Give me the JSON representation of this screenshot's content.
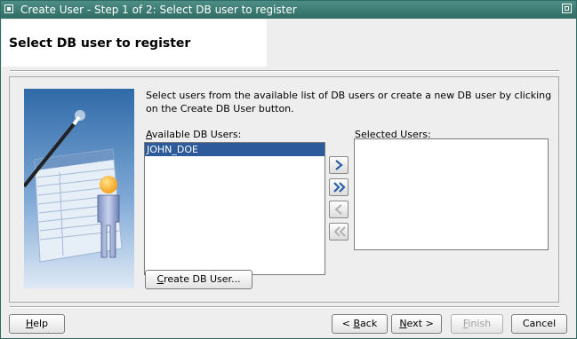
{
  "window": {
    "title": "Create User - Step 1 of 2: Select DB user to register"
  },
  "header": {
    "page_title": "Select DB user to register"
  },
  "main": {
    "instructions": "Select users from the available list of DB users or create a new DB user by clicking on the Create DB User button.",
    "available": {
      "label_pre": "",
      "label_key": "A",
      "label_post": "vailable DB Users:",
      "items": [
        "JOHN_DOE"
      ],
      "selected_index": 0
    },
    "selected": {
      "label_pre": "",
      "label_key": "S",
      "label_post": "elected Users:",
      "items": []
    },
    "shuttle_buttons": [
      {
        "name": "move-right",
        "icon": "chevron-right-icon",
        "enabled": true
      },
      {
        "name": "move-all-right",
        "icon": "double-chevron-right-icon",
        "enabled": true
      },
      {
        "name": "move-left",
        "icon": "chevron-left-icon",
        "enabled": false
      },
      {
        "name": "move-all-left",
        "icon": "double-chevron-left-icon",
        "enabled": false
      }
    ],
    "create_button": {
      "pre": "",
      "key": "C",
      "post": "reate DB User..."
    }
  },
  "footer": {
    "help": {
      "pre": "",
      "key": "H",
      "post": "elp"
    },
    "back": {
      "pre": "< ",
      "key": "B",
      "post": "ack"
    },
    "next": {
      "pre": "",
      "key": "N",
      "post": "ext >"
    },
    "finish": {
      "pre": "",
      "key": "F",
      "post": "inish",
      "enabled": false
    },
    "cancel": {
      "label": "Cancel"
    }
  },
  "colors": {
    "titlebar": "#3a7a72",
    "selection": "#2c5a9a",
    "shuttle_arrow": "#2a5fa8"
  }
}
